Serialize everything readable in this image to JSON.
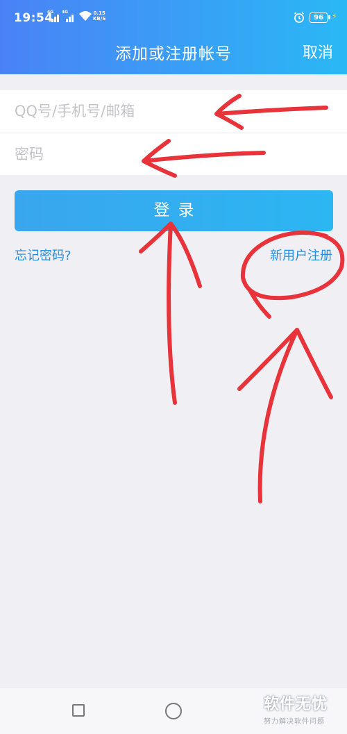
{
  "status_bar": {
    "time": "19:54",
    "sim1_label": "4G",
    "sim2_label": "4G",
    "speed_value": "0.15",
    "speed_unit": "KB/S",
    "battery": "96"
  },
  "header": {
    "title": "添加或注册帐号",
    "cancel_label": "取消"
  },
  "form": {
    "username_placeholder": "QQ号/手机号/邮箱",
    "username_value": "",
    "password_placeholder": "密码",
    "password_value": ""
  },
  "login_button_label": "登录",
  "links": {
    "forgot_password": "忘记密码?",
    "new_user_register": "新用户注册"
  },
  "watermark": {
    "main": "软件无忧",
    "sub": "努力解决软件问题"
  },
  "annotation_color": "#e8333a",
  "icons": [
    "signal-icon",
    "wifi-icon",
    "alarm-icon",
    "battery-icon",
    "charging-icon",
    "recent-apps-icon",
    "home-icon"
  ]
}
